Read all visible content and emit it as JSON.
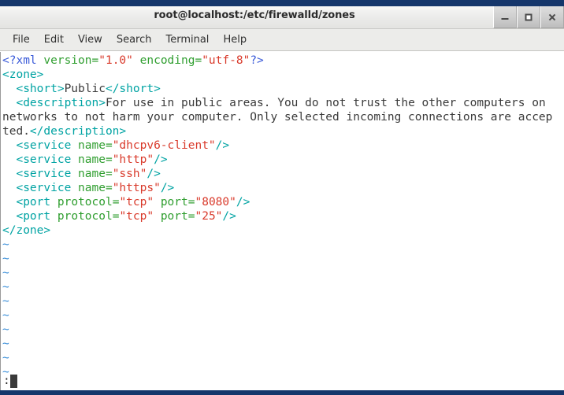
{
  "window": {
    "title": "root@localhost:/etc/firewalld/zones",
    "controls": [
      {
        "name": "minimize",
        "glyph": "minimize-icon"
      },
      {
        "name": "maximize",
        "glyph": "maximize-icon"
      },
      {
        "name": "close",
        "glyph": "close-icon"
      }
    ]
  },
  "menubar": {
    "items": [
      {
        "label": "File"
      },
      {
        "label": "Edit"
      },
      {
        "label": "View"
      },
      {
        "label": "Search"
      },
      {
        "label": "Terminal"
      },
      {
        "label": "Help"
      }
    ]
  },
  "editor": {
    "filetype": "xml",
    "colors": {
      "tag": "#00a3a3",
      "attribute": "#2f9e2f",
      "value": "#d93a2b",
      "processing_instruction": "#3b5bd9",
      "text": "#3b3b3b",
      "tilde": "#3b8fd9",
      "background": "#ffffff"
    },
    "lines": [
      {
        "segments": [
          {
            "t": "<?xml ",
            "c": "pi"
          },
          {
            "t": "version=",
            "c": "attr"
          },
          {
            "t": "\"1.0\"",
            "c": "val"
          },
          {
            "t": " ",
            "c": "txt"
          },
          {
            "t": "encoding=",
            "c": "attr"
          },
          {
            "t": "\"utf-8\"",
            "c": "val"
          },
          {
            "t": "?>",
            "c": "pi"
          }
        ]
      },
      {
        "segments": [
          {
            "t": "<zone>",
            "c": "tag"
          }
        ]
      },
      {
        "segments": [
          {
            "t": "  ",
            "c": "txt"
          },
          {
            "t": "<short>",
            "c": "tag"
          },
          {
            "t": "Public",
            "c": "txt"
          },
          {
            "t": "</short>",
            "c": "tag"
          }
        ]
      },
      {
        "segments": [
          {
            "t": "  ",
            "c": "txt"
          },
          {
            "t": "<description>",
            "c": "tag"
          },
          {
            "t": "For use in public areas. You do not trust the other computers on ",
            "c": "txt"
          }
        ]
      },
      {
        "segments": [
          {
            "t": "networks to not harm your computer. Only selected incoming connections are accep",
            "c": "txt"
          }
        ]
      },
      {
        "segments": [
          {
            "t": "ted.",
            "c": "txt"
          },
          {
            "t": "</description>",
            "c": "tag"
          }
        ]
      },
      {
        "segments": [
          {
            "t": "  ",
            "c": "txt"
          },
          {
            "t": "<service ",
            "c": "tag"
          },
          {
            "t": "name=",
            "c": "attr"
          },
          {
            "t": "\"dhcpv6-client\"",
            "c": "val"
          },
          {
            "t": "/>",
            "c": "tag"
          }
        ]
      },
      {
        "segments": [
          {
            "t": "  ",
            "c": "txt"
          },
          {
            "t": "<service ",
            "c": "tag"
          },
          {
            "t": "name=",
            "c": "attr"
          },
          {
            "t": "\"http\"",
            "c": "val"
          },
          {
            "t": "/>",
            "c": "tag"
          }
        ]
      },
      {
        "segments": [
          {
            "t": "  ",
            "c": "txt"
          },
          {
            "t": "<service ",
            "c": "tag"
          },
          {
            "t": "name=",
            "c": "attr"
          },
          {
            "t": "\"ssh\"",
            "c": "val"
          },
          {
            "t": "/>",
            "c": "tag"
          }
        ]
      },
      {
        "segments": [
          {
            "t": "  ",
            "c": "txt"
          },
          {
            "t": "<service ",
            "c": "tag"
          },
          {
            "t": "name=",
            "c": "attr"
          },
          {
            "t": "\"https\"",
            "c": "val"
          },
          {
            "t": "/>",
            "c": "tag"
          }
        ]
      },
      {
        "segments": [
          {
            "t": "  ",
            "c": "txt"
          },
          {
            "t": "<port ",
            "c": "tag"
          },
          {
            "t": "protocol=",
            "c": "attr"
          },
          {
            "t": "\"tcp\"",
            "c": "val"
          },
          {
            "t": " ",
            "c": "txt"
          },
          {
            "t": "port=",
            "c": "attr"
          },
          {
            "t": "\"8080\"",
            "c": "val"
          },
          {
            "t": "/>",
            "c": "tag"
          }
        ]
      },
      {
        "segments": [
          {
            "t": "  ",
            "c": "txt"
          },
          {
            "t": "<port ",
            "c": "tag"
          },
          {
            "t": "protocol=",
            "c": "attr"
          },
          {
            "t": "\"tcp\"",
            "c": "val"
          },
          {
            "t": " ",
            "c": "txt"
          },
          {
            "t": "port=",
            "c": "attr"
          },
          {
            "t": "\"25\"",
            "c": "val"
          },
          {
            "t": "/>",
            "c": "tag"
          }
        ]
      },
      {
        "segments": [
          {
            "t": "</zone>",
            "c": "tag"
          }
        ]
      }
    ],
    "empty_line_marker": "~",
    "empty_line_count": 10
  },
  "command_line": {
    "prompt": ":",
    "value": "",
    "cursor": "block"
  }
}
